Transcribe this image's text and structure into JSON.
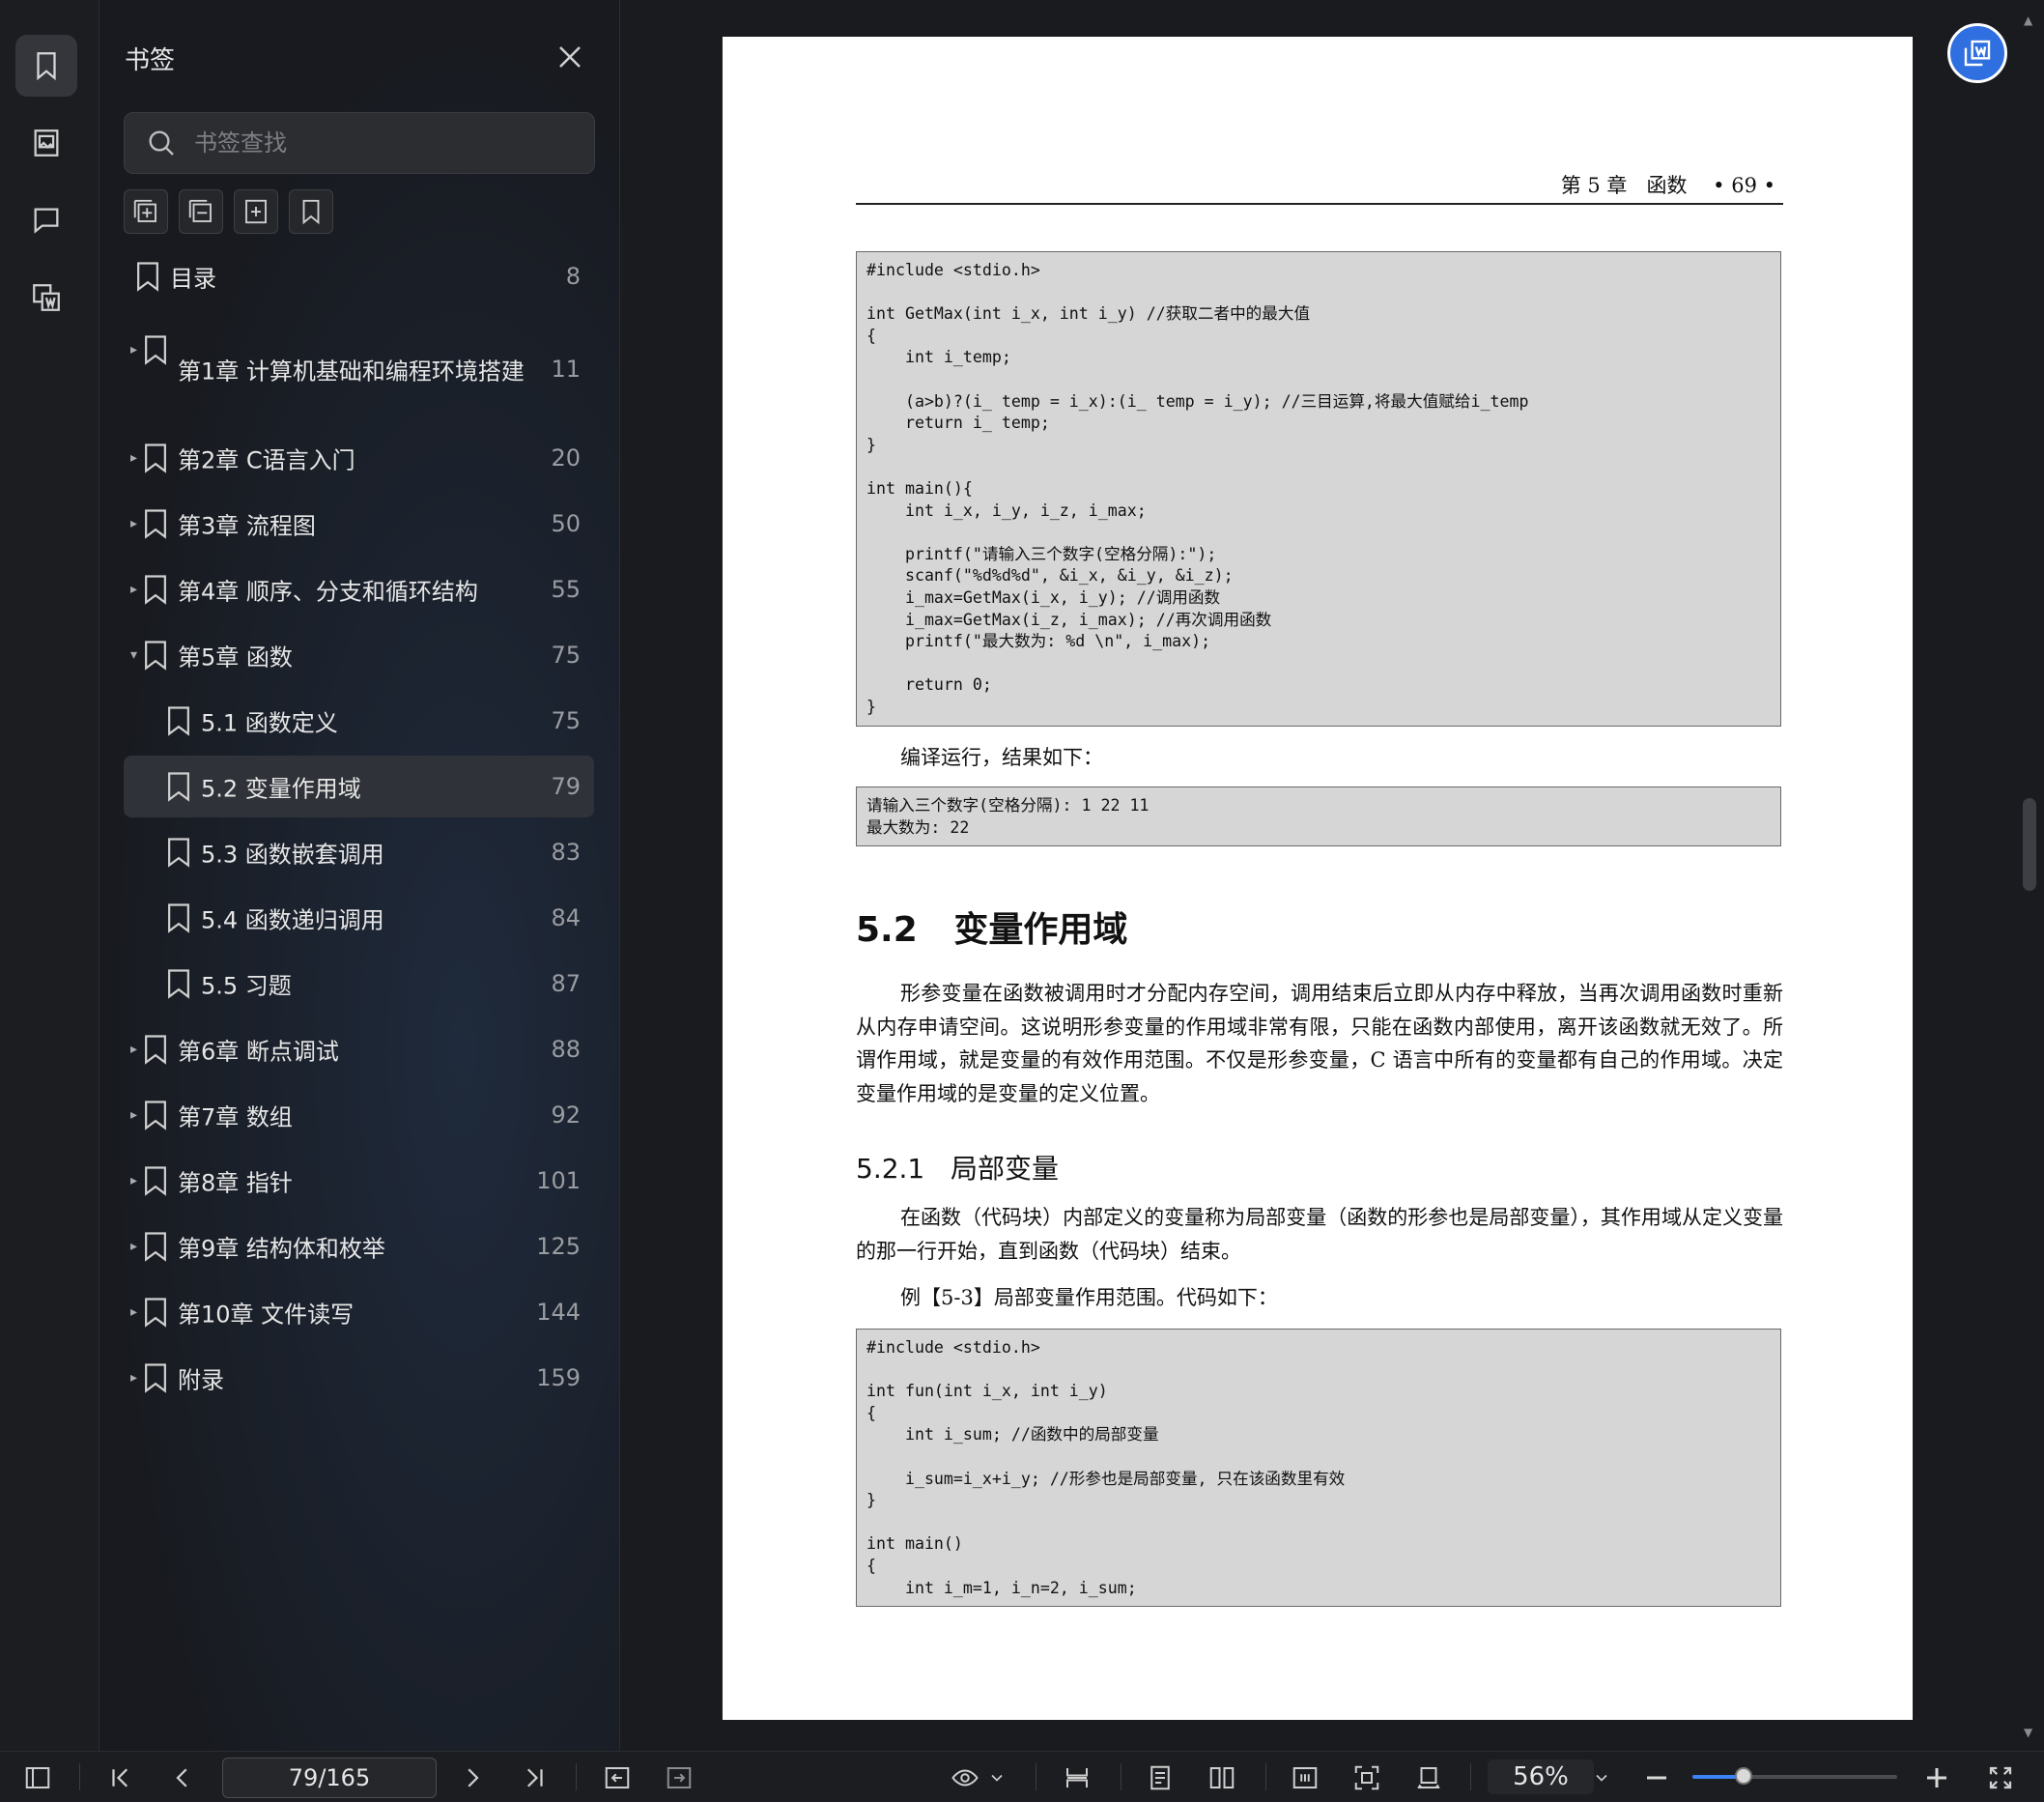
{
  "sidebar": {
    "title": "书签",
    "search_placeholder": "书签查找",
    "bookmarks": [
      {
        "label": "目录",
        "page": "8",
        "level": 0,
        "arrow": ""
      },
      {
        "label": "第1章 计算机基础和编程环境搭建",
        "page": "11",
        "level": 0,
        "arrow": "▸"
      },
      {
        "label": "第2章 C语言入门",
        "page": "20",
        "level": 0,
        "arrow": "▸"
      },
      {
        "label": "第3章 流程图",
        "page": "50",
        "level": 0,
        "arrow": "▸"
      },
      {
        "label": "第4章 顺序、分支和循环结构",
        "page": "55",
        "level": 0,
        "arrow": "▸"
      },
      {
        "label": "第5章 函数",
        "page": "75",
        "level": 0,
        "arrow": "▾"
      },
      {
        "label": "5.1 函数定义",
        "page": "75",
        "level": 1,
        "arrow": ""
      },
      {
        "label": "5.2 变量作用域",
        "page": "79",
        "level": 1,
        "arrow": "",
        "selected": true
      },
      {
        "label": "5.3 函数嵌套调用",
        "page": "83",
        "level": 1,
        "arrow": ""
      },
      {
        "label": "5.4 函数递归调用",
        "page": "84",
        "level": 1,
        "arrow": ""
      },
      {
        "label": "5.5 习题",
        "page": "87",
        "level": 1,
        "arrow": ""
      },
      {
        "label": "第6章 断点调试",
        "page": "88",
        "level": 0,
        "arrow": "▸"
      },
      {
        "label": "第7章 数组",
        "page": "92",
        "level": 0,
        "arrow": "▸"
      },
      {
        "label": "第8章 指针",
        "page": "101",
        "level": 0,
        "arrow": "▸"
      },
      {
        "label": "第9章 结构体和枚举",
        "page": "125",
        "level": 0,
        "arrow": "▸"
      },
      {
        "label": "第10章 文件读写",
        "page": "144",
        "level": 0,
        "arrow": "▸"
      },
      {
        "label": "附录",
        "page": "159",
        "level": 0,
        "arrow": "▸"
      }
    ]
  },
  "document": {
    "running_head": "第 5 章   函数    • 69 •",
    "code1": "#include <stdio.h>\n\nint GetMax(int i_x, int i_y) //获取二者中的最大值\n{\n    int i_temp;\n\n    (a>b)?(i_ temp = i_x):(i_ temp = i_y); //三目运算,将最大值赋给i_temp\n    return i_ temp;\n}\n\nint main(){\n    int i_x, i_y, i_z, i_max;\n\n    printf(\"请输入三个数字(空格分隔):\");\n    scanf(\"%d%d%d\", &i_x, &i_y, &i_z);\n    i_max=GetMax(i_x, i_y); //调用函数\n    i_max=GetMax(i_z, i_max); //再次调用函数\n    printf(\"最大数为: %d \\n\", i_max);\n\n    return 0;\n}",
    "compile_text": "编译运行，结果如下：",
    "output": "请输入三个数字(空格分隔): 1 22 11\n最大数为: 22",
    "section_title": "5.2   变量作用域",
    "section_para": "形参变量在函数被调用时才分配内存空间，调用结束后立即从内存中释放，当再次调用函数时重新从内存申请空间。这说明形参变量的作用域非常有限，只能在函数内部使用，离开该函数就无效了。所谓作用域，就是变量的有效作用范围。不仅是形参变量，C 语言中所有的变量都有自己的作用域。决定变量作用域的是变量的定义位置。",
    "subsection_title": "5.2.1   局部变量",
    "subsection_para": "在函数（代码块）内部定义的变量称为局部变量（函数的形参也是局部变量），其作用域从定义变量的那一行开始，直到函数（代码块）结束。",
    "example_line": "例【5-3】局部变量作用范围。代码如下：",
    "code2": "#include <stdio.h>\n\nint fun(int i_x, int i_y)\n{\n    int i_sum; //函数中的局部变量\n\n    i_sum=i_x+i_y; //形参也是局部变量, 只在该函数里有效\n}\n\nint main()\n{\n    int i_m=1, i_n=2, i_sum;"
  },
  "toolbar": {
    "page_indicator": "79/165",
    "zoom": "56%",
    "zoom_fraction": 0.25
  }
}
